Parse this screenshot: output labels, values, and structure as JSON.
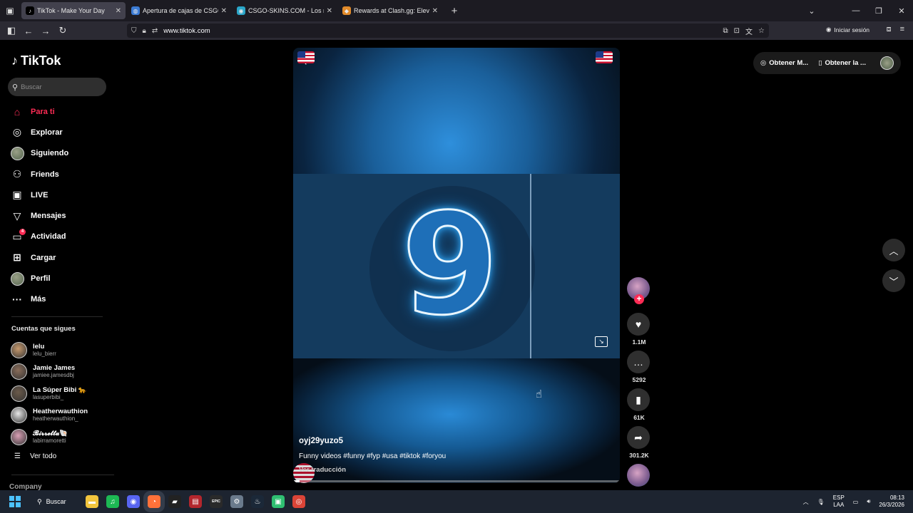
{
  "browser": {
    "tabs": [
      {
        "label": "TikTok - Make Your Day",
        "active": true,
        "favicon": "tiktok-icon"
      },
      {
        "label": "Apertura de cajas de CSGO y CS",
        "active": false,
        "favicon": "globe-icon"
      },
      {
        "label": "CSGO-SKINS.COM - Los mejores",
        "active": false,
        "favicon": "target-icon"
      },
      {
        "label": "Rewards at Clash.gg: Elevate Yo",
        "active": false,
        "favicon": "diamond-icon"
      }
    ],
    "url": "www.tiktok.com",
    "signin_label": "Iniciar sesión"
  },
  "sidebar": {
    "logo_text": "TikTok",
    "search_placeholder": "Buscar",
    "nav": [
      {
        "label": "Para ti",
        "icon": "home-icon",
        "active": true
      },
      {
        "label": "Explorar",
        "icon": "compass-icon"
      },
      {
        "label": "Siguiendo",
        "icon": "avatar-icon"
      },
      {
        "label": "Friends",
        "icon": "people-icon"
      },
      {
        "label": "LIVE",
        "icon": "live-icon"
      },
      {
        "label": "Mensajes",
        "icon": "send-icon"
      },
      {
        "label": "Actividad",
        "icon": "inbox-icon",
        "badge": "4"
      },
      {
        "label": "Cargar",
        "icon": "plus-box-icon"
      },
      {
        "label": "Perfil",
        "icon": "avatar-icon"
      },
      {
        "label": "Más",
        "icon": "more-icon"
      }
    ],
    "following_title": "Cuentas que sigues",
    "following": [
      {
        "name": "lelu",
        "user": "lelu_bierr",
        "color": "#c79a6e"
      },
      {
        "name": "Jamie James",
        "user": "jamiee.jamesdbj",
        "color": "#8a6d5a"
      },
      {
        "name": "La Súper Bibi 🐆",
        "user": "lasuperbibi_",
        "color": "#6b5a4a"
      },
      {
        "name": "Heatherwauthion",
        "user": "heatherwauthion_",
        "color": "#e8e8e8"
      },
      {
        "name": "𝓑𝓲𝓻𝓻𝓮𝓽𝓽𝓪🐚",
        "user": "labirramoretti",
        "color": "#d9a0b5"
      }
    ],
    "see_all": "Ver todo",
    "company": "Company"
  },
  "video": {
    "number_shown": "9",
    "author": "oyj29yuzo5",
    "description": "Funny videos #funny #fyp #usa #tiktok #foryou",
    "translate": "Ver traducción",
    "progress_fraction": 0.02
  },
  "actions": {
    "likes": "1.1M",
    "comments": "5292",
    "saves": "61K",
    "shares": "301.2K"
  },
  "topbar": {
    "get_coins": "Obtener M...",
    "get_app": "Obtener la ..."
  },
  "taskbar": {
    "search_label": "Buscar",
    "lang_top": "ESP",
    "lang_bottom": "LAA",
    "time": "08:13",
    "date": "26/3/2026",
    "apps": [
      {
        "name": "file-explorer",
        "color": "#f2c53d",
        "glyph": "▬"
      },
      {
        "name": "spotify",
        "color": "#1db954",
        "glyph": "♫"
      },
      {
        "name": "discord",
        "color": "#5865f2",
        "glyph": "◉"
      },
      {
        "name": "firefox",
        "color": "#ff7139",
        "glyph": "◔"
      },
      {
        "name": "app-dark",
        "color": "#222222",
        "glyph": "▰"
      },
      {
        "name": "app-red",
        "color": "#b3262d",
        "glyph": "▤"
      },
      {
        "name": "epic-games",
        "color": "#2a2a2a",
        "glyph": "EPIC"
      },
      {
        "name": "settings",
        "color": "#6a7a8c",
        "glyph": "⚙"
      },
      {
        "name": "steam",
        "color": "#1b2838",
        "glyph": "♨"
      },
      {
        "name": "app-green",
        "color": "#2fbf71",
        "glyph": "▣"
      },
      {
        "name": "chrome",
        "color": "#db4437",
        "glyph": "◎"
      }
    ]
  },
  "colors": {
    "accent": "#fe2c55",
    "background": "#000000"
  }
}
